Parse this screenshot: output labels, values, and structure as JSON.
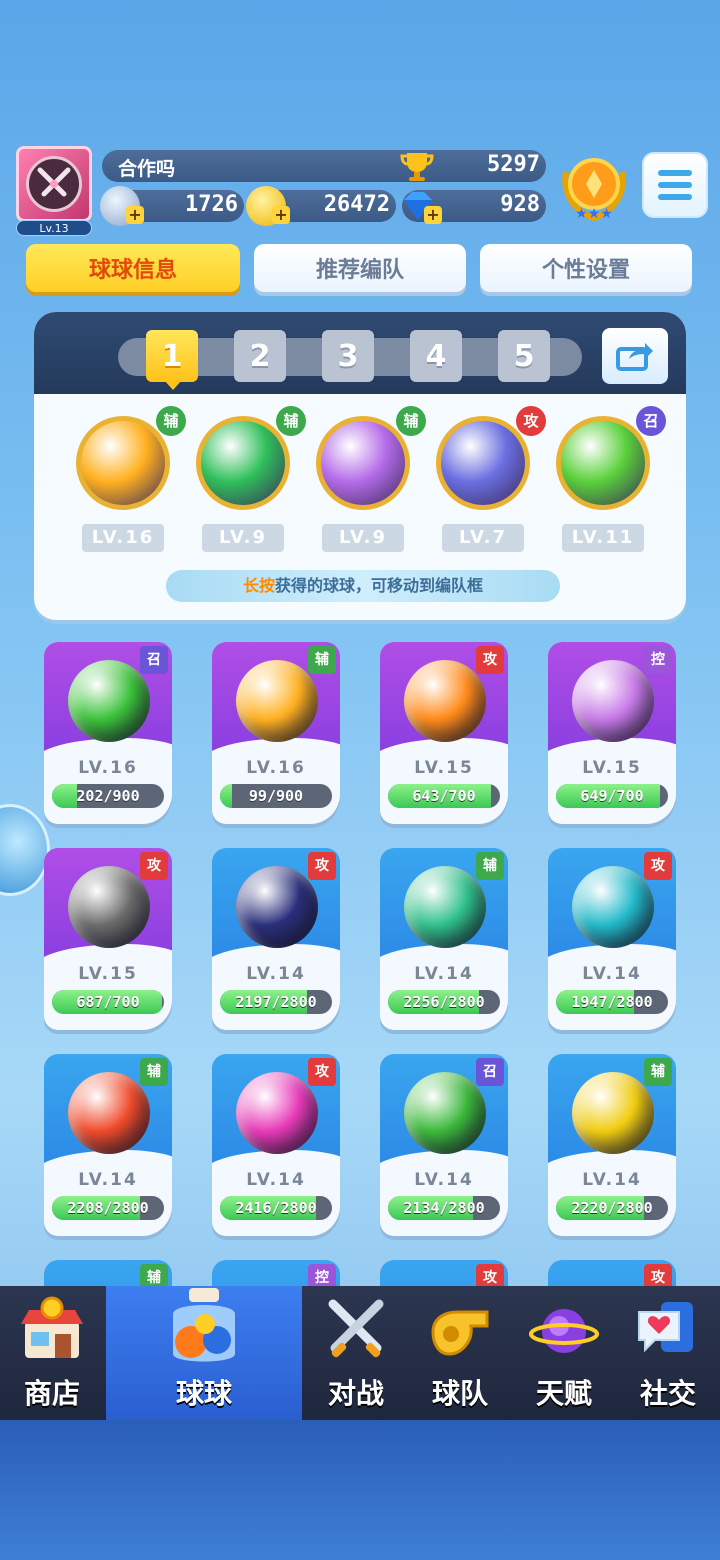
{
  "header": {
    "player_name": "合作吗",
    "level": "Lv.13",
    "trophies": "5297",
    "resources": [
      {
        "name": "stamina",
        "icon": "star-coin-icon",
        "value": "1726"
      },
      {
        "name": "gold",
        "icon": "gold-coin-icon",
        "value": "26472"
      },
      {
        "name": "diamond",
        "icon": "diamond-icon",
        "value": "928"
      }
    ]
  },
  "tabs": [
    {
      "label": "球球信息",
      "active": true
    },
    {
      "label": "推荐编队",
      "active": false
    },
    {
      "label": "个性设置",
      "active": false
    }
  ],
  "team": {
    "slots": [
      "1",
      "2",
      "3",
      "4",
      "5"
    ],
    "active_slot": "1",
    "balls": [
      {
        "role": "辅",
        "level": "LV.16",
        "color": "#ffb020"
      },
      {
        "role": "辅",
        "level": "LV.9",
        "color": "#2fbf5a"
      },
      {
        "role": "辅",
        "level": "LV.9",
        "color": "#b46be8"
      },
      {
        "role": "攻",
        "level": "LV.7",
        "color": "#6a6ee0"
      },
      {
        "role": "召",
        "level": "LV.11",
        "color": "#5ad03a"
      }
    ],
    "hint_highlight": "长按",
    "hint_text": "获得的球球，可移动到编队框"
  },
  "cards": [
    {
      "role": "召",
      "level": "LV.16",
      "progress": "202/900",
      "fill": 0.22,
      "bg": "purple",
      "ball": "#3cc23a"
    },
    {
      "role": "辅",
      "level": "LV.16",
      "progress": "99/900",
      "fill": 0.11,
      "bg": "purple",
      "ball": "#ffb020"
    },
    {
      "role": "攻",
      "level": "LV.15",
      "progress": "643/700",
      "fill": 0.92,
      "bg": "purple",
      "ball": "#ff8a1a"
    },
    {
      "role": "控",
      "level": "LV.15",
      "progress": "649/700",
      "fill": 0.93,
      "bg": "purple",
      "ball": "#c77ae6"
    },
    {
      "role": "攻",
      "level": "LV.15",
      "progress": "687/700",
      "fill": 0.98,
      "bg": "purple",
      "ball": "#6b6b6b"
    },
    {
      "role": "攻",
      "level": "LV.14",
      "progress": "2197/2800",
      "fill": 0.78,
      "bg": "blue",
      "ball": "#2a2f7a"
    },
    {
      "role": "辅",
      "level": "LV.14",
      "progress": "2256/2800",
      "fill": 0.81,
      "bg": "blue",
      "ball": "#2fc08a"
    },
    {
      "role": "攻",
      "level": "LV.14",
      "progress": "1947/2800",
      "fill": 0.7,
      "bg": "blue",
      "ball": "#22b9c9"
    },
    {
      "role": "辅",
      "level": "LV.14",
      "progress": "2208/2800",
      "fill": 0.79,
      "bg": "blue",
      "ball": "#f04a2a"
    },
    {
      "role": "攻",
      "level": "LV.14",
      "progress": "2416/2800",
      "fill": 0.86,
      "bg": "blue",
      "ball": "#e83ab8"
    },
    {
      "role": "召",
      "level": "LV.14",
      "progress": "2134/2800",
      "fill": 0.76,
      "bg": "blue",
      "ball": "#3bb83a"
    },
    {
      "role": "辅",
      "level": "LV.14",
      "progress": "2220/2800",
      "fill": 0.79,
      "bg": "blue",
      "ball": "#f0cc10"
    }
  ],
  "partial_cards_roles": [
    "辅",
    "控",
    "攻",
    "攻"
  ],
  "nav": [
    {
      "label": "商店",
      "icon": "shop-icon",
      "active": false
    },
    {
      "label": "球球",
      "icon": "ball-jar-icon",
      "active": true
    },
    {
      "label": "对战",
      "icon": "crossed-swords-icon",
      "active": false
    },
    {
      "label": "球队",
      "icon": "whistle-icon",
      "active": false
    },
    {
      "label": "天赋",
      "icon": "planet-icon",
      "active": false
    },
    {
      "label": "社交",
      "icon": "chat-heart-icon",
      "active": false
    }
  ],
  "colors": {
    "accent_yellow": "#ffcf26",
    "tab_active_text": "#e2490a",
    "nav_active": "#3d7ef0"
  }
}
